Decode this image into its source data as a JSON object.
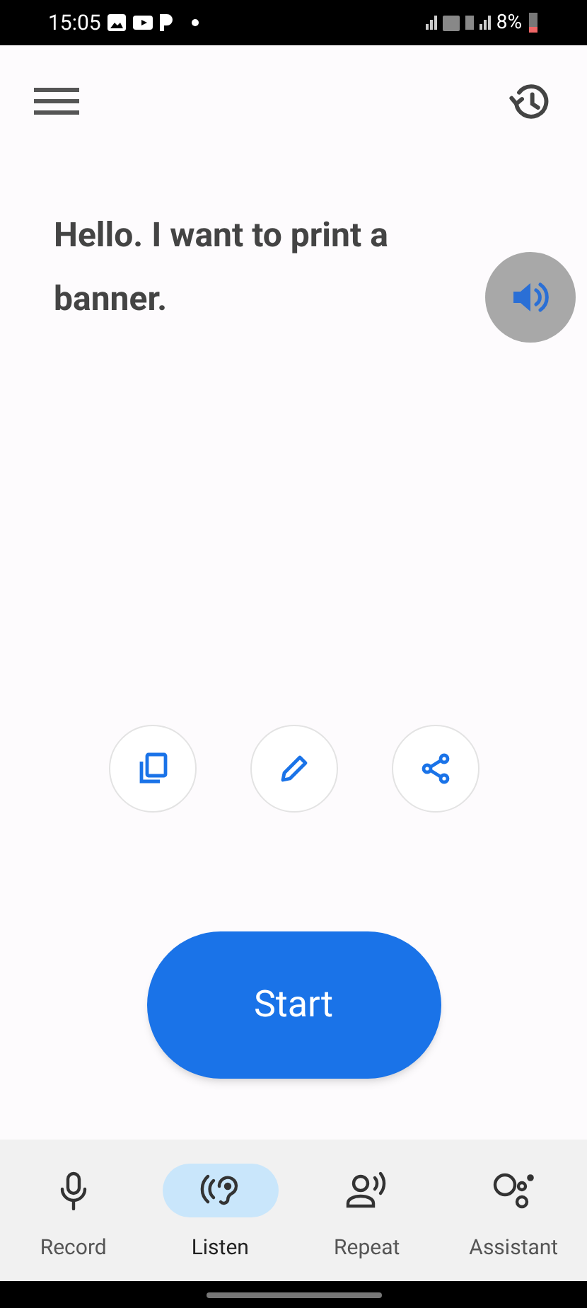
{
  "status_bar": {
    "time": "15:05",
    "battery": "8%"
  },
  "transcript": {
    "text": "Hello. I want to print a banner."
  },
  "start_button": {
    "label": "Start"
  },
  "nav": [
    {
      "kind": "record",
      "label": "Record",
      "selected": false
    },
    {
      "kind": "listen",
      "label": "Listen",
      "selected": true
    },
    {
      "kind": "repeat",
      "label": "Repeat",
      "selected": false
    },
    {
      "kind": "assistant",
      "label": "Assistant",
      "selected": false
    }
  ]
}
